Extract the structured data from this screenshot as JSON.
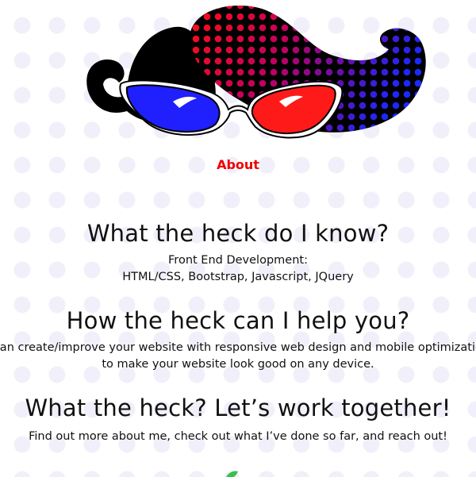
{
  "nav": {
    "about_label": "About"
  },
  "sections": [
    {
      "heading": "What the heck do I know?",
      "lines": [
        "Front End Development:",
        "HTML/CSS, Bootstrap, Javascript, JQuery"
      ]
    },
    {
      "heading": "How the heck can I help you?",
      "lines": [
        "I can create/improve your website with responsive web design and mobile optimization",
        "to make your website look good on any device."
      ]
    },
    {
      "heading": "What the heck? Let’s work together!",
      "lines": [
        "Find out more about me, check out what I’ve done so far, and reach out!"
      ]
    }
  ],
  "colors": {
    "accent": "#ee0000",
    "lens_left": "#2020ff",
    "lens_right": "#ff1a1a",
    "leaf": "#3bbf4f"
  },
  "icons": {
    "logo": "mustache-glasses-logo",
    "footer": "leaf-icon"
  }
}
